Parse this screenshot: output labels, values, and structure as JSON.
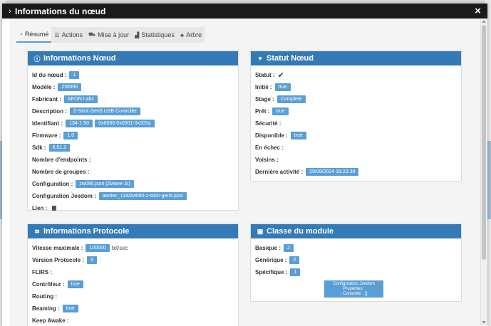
{
  "modal": {
    "title": "Informations du nœud",
    "chevron": "›",
    "close": "×"
  },
  "tabs": [
    {
      "label": "Résumé",
      "icon": "tachometer-icon",
      "glyph": "◔"
    },
    {
      "label": "Actions",
      "icon": "list-icon",
      "glyph": "☰"
    },
    {
      "label": "Mise à jour",
      "icon": "truck-icon",
      "glyph": "⛟"
    },
    {
      "label": "Statistiques",
      "icon": "bar-chart-icon",
      "glyph": "▟"
    },
    {
      "label": "Arbre",
      "icon": "sitemap-icon",
      "glyph": "♣"
    }
  ],
  "info_noeud": {
    "title": "Informations Nœud",
    "id_label": "Id du nœud :",
    "id_value": "1",
    "modele_label": "Modèle :",
    "modele_value": "ZW090",
    "fabricant_label": "Fabricant :",
    "fabricant_value": "AEON Labs",
    "description_label": "Description :",
    "description_value": "Z-Stick Gen5 USB Controller",
    "identifiant_label": "Identifiant :",
    "identifiant_value1": "134-1-90",
    "identifiant_value2": "0x0086-0x0001-0x005a",
    "firmware_label": "Firmware :",
    "firmware_value": "1.0",
    "sdk_label": "Sdk :",
    "sdk_value": "6.51.2",
    "endpoints_label": "Nombre d'endpoints :",
    "groupes_label": "Nombre de groupes :",
    "configuration_label": "Configuration :",
    "configuration_value": "zw090.json (Zwave-Js)",
    "config_jeedom_label": "Configuration Jeedom :",
    "config_jeedom_value": "aeotec_134/zw090.z-stick-gen5.json",
    "lien_label": "Lien :"
  },
  "statut_noeud": {
    "title": "Statut Nœud",
    "statut_label": "Statut :",
    "statut_mark": "✔",
    "initie_label": "Initié :",
    "initie_value": "true",
    "stage_label": "Stage :",
    "stage_value": "Complete",
    "pret_label": "Prêt :",
    "pret_value": "true",
    "securite_label": "Sécurité :",
    "disponible_label": "Disponible :",
    "disponible_value": "true",
    "echec_label": "En échec :",
    "voisins_label": "Voisins :",
    "derniere_label": "Dernière activité :",
    "derniere_value": "29/09/2024 19:20:38"
  },
  "info_protocole": {
    "title": "Informations Protocole",
    "vitesse_label": "Vitesse maximale :",
    "vitesse_value": "100000",
    "vitesse_unit": "bit/sec",
    "version_label": "Version Protocole :",
    "version_value": "3",
    "flirs_label": "FLIRS :",
    "controleur_label": "Contrôleur :",
    "controleur_value": "true",
    "routing_label": "Routing :",
    "beaming_label": "Beaming :",
    "beaming_value": "true",
    "keepawake_label": "Keep Awake :"
  },
  "classe_module": {
    "title": "Classe du module",
    "basique_label": "Basique :",
    "basique_value": "2",
    "generique_label": "Générique :",
    "generique_value": "2",
    "specifique_label": "Spécifique :",
    "specifique_value": "1",
    "cfg_line1": "Configuration Jeedom",
    "cfg_line2": "Properties :",
    "cfg_line3": "- Controller : []"
  }
}
